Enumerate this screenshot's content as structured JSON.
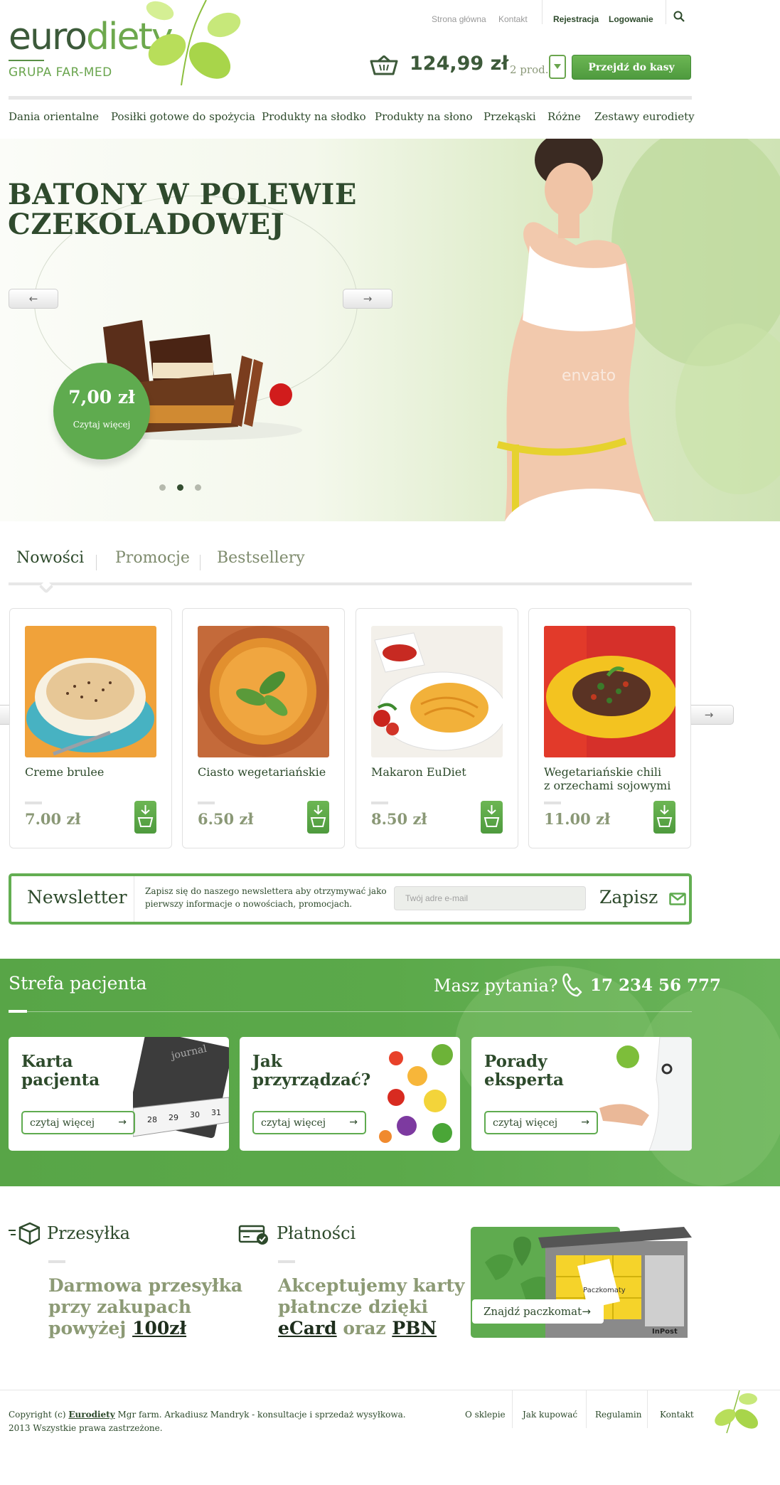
{
  "header": {
    "logo_euro": "euro",
    "logo_diety": "diety",
    "logo_sub": "GRUPA FAR-MED",
    "toplinks": [
      "Strona główna",
      "Kontakt"
    ],
    "register": "Rejestracja",
    "login": "Logowanie",
    "cart_total": "124,99 zł",
    "cart_count": "2 prod.",
    "checkout": "Przejdź do kasy",
    "nav": [
      "Dania orientalne",
      "Posiłki gotowe do spożycia",
      "Produkty na słodko",
      "Produkty na słono",
      "Przekąski",
      "Różne",
      "Zestawy eurodiety"
    ]
  },
  "hero": {
    "title_line1": "BATONY W POLEWIE",
    "title_line2": "CZEKOLADOWEJ",
    "price": "7,00 zł",
    "read_more": "Czytaj więcej",
    "watermark": "envato",
    "slides": 3,
    "active_slide": 2
  },
  "tabs": [
    "Nowości",
    "Promocje",
    "Bestsellery"
  ],
  "products": [
    {
      "name": "Creme brulee",
      "price": "7.00 zł"
    },
    {
      "name": "Ciasto wegetariańskie",
      "price": "6.50 zł"
    },
    {
      "name": "Makaron EuDiet",
      "price": "8.50 zł"
    },
    {
      "name_line1": "Wegetariańskie chili",
      "name_line2": "z orzechami sojowymi",
      "price": "11.00 zł"
    }
  ],
  "newsletter": {
    "title": "Newsletter",
    "desc": "Zapisz się do naszego newslettera aby otrzymywać jako pierwszy informacje o nowościach, promocjach.",
    "placeholder": "Twój adre e-mail",
    "button": "Zapisz"
  },
  "patient": {
    "title": "Strefa pacjenta",
    "question": "Masz pytania?",
    "phone": "17 234 56 777",
    "cards": [
      {
        "title_line1": "Karta",
        "title_line2": "pacjenta",
        "button": "czytaj więcej",
        "image_text": "journal"
      },
      {
        "title_line1": "Jak",
        "title_line2": "przyrządzać?",
        "button": "czytaj więcej"
      },
      {
        "title_line1": "Porady",
        "title_line2": "eksperta",
        "button": "czytaj więcej"
      }
    ]
  },
  "info": {
    "shipping_title": "Przesyłka",
    "shipping_l1": "Darmowa przesyłka",
    "shipping_l2": "przy zakupach",
    "shipping_l3a": "powyżej ",
    "shipping_l3b": "100zł",
    "payment_title": "Płatności",
    "payment_l1": "Akceptujemy karty",
    "payment_l2": "płatncze dzięki",
    "payment_ecard": "eCard",
    "payment_oraz": " oraz ",
    "payment_pbn": "PBN",
    "parcel_button": "Znajdź paczkomat",
    "parcel_label": "Paczkomaty",
    "parcel_brand": "InPost"
  },
  "footer": {
    "copy_a": "Copyright (c) ",
    "copy_brand": "Eurodiety",
    "copy_b": " Mgr farm. Arkadiusz Mandryk - konsultacje i sprzedaż wysyłkowa.",
    "copy_line2": "2013 Wszystkie prawa zastrzeżone.",
    "links": [
      "O sklepie",
      "Jak kupować",
      "Regulamin",
      "Kontakt"
    ]
  },
  "colors": {
    "brand_green": "#5fab4f",
    "dark_green": "#2d4a2b",
    "muted": "#8c9a75"
  }
}
